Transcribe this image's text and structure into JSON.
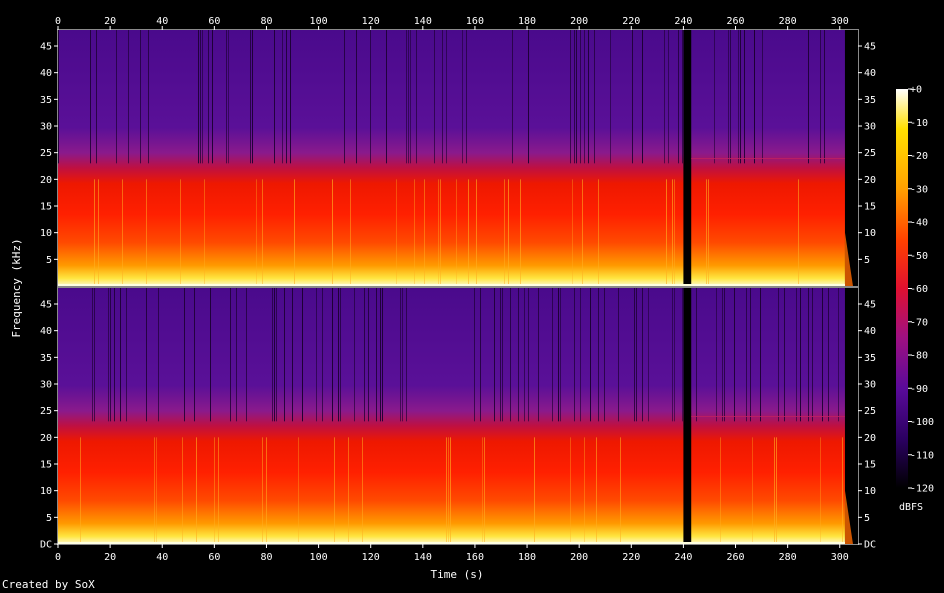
{
  "chart_data": {
    "type": "heatmap",
    "title": "",
    "xlabel": "Time (s)",
    "ylabel": "Frequency (kHz)",
    "colorbar_label": "dBFS",
    "x_ticks": [
      0,
      20,
      40,
      60,
      80,
      100,
      120,
      140,
      160,
      180,
      200,
      220,
      240,
      260,
      280,
      300
    ],
    "xlim": [
      0,
      307
    ],
    "ylim": [
      0,
      48
    ],
    "channels": [
      {
        "y_ticks": [
          "5",
          "10",
          "15",
          "20",
          "25",
          "30",
          "35",
          "40",
          "45"
        ]
      },
      {
        "y_ticks": [
          "DC",
          "5",
          "10",
          "15",
          "20",
          "25",
          "30",
          "35",
          "40",
          "45"
        ]
      }
    ],
    "colorbar_ticks": [
      "+0",
      "-10",
      "-20",
      "-30",
      "-40",
      "-50",
      "-60",
      "-70",
      "-80",
      "-90",
      "-100",
      "-110",
      "-120"
    ],
    "clim": [
      -120,
      0
    ],
    "colormap": [
      "#000000",
      "#2a0050",
      "#5a0a9a",
      "#9a1a9a",
      "#d4204a",
      "#ff2a00",
      "#ff6a00",
      "#ffb000",
      "#ffe000",
      "#ffffff"
    ],
    "features": {
      "music_end_s": 302,
      "gap_start_s": 240,
      "gap_end_s": 243,
      "bright_band_khz": [
        0,
        3
      ],
      "red_band_khz": [
        4,
        20
      ],
      "purple_above_khz": 24
    }
  },
  "credit": "Created by SoX"
}
